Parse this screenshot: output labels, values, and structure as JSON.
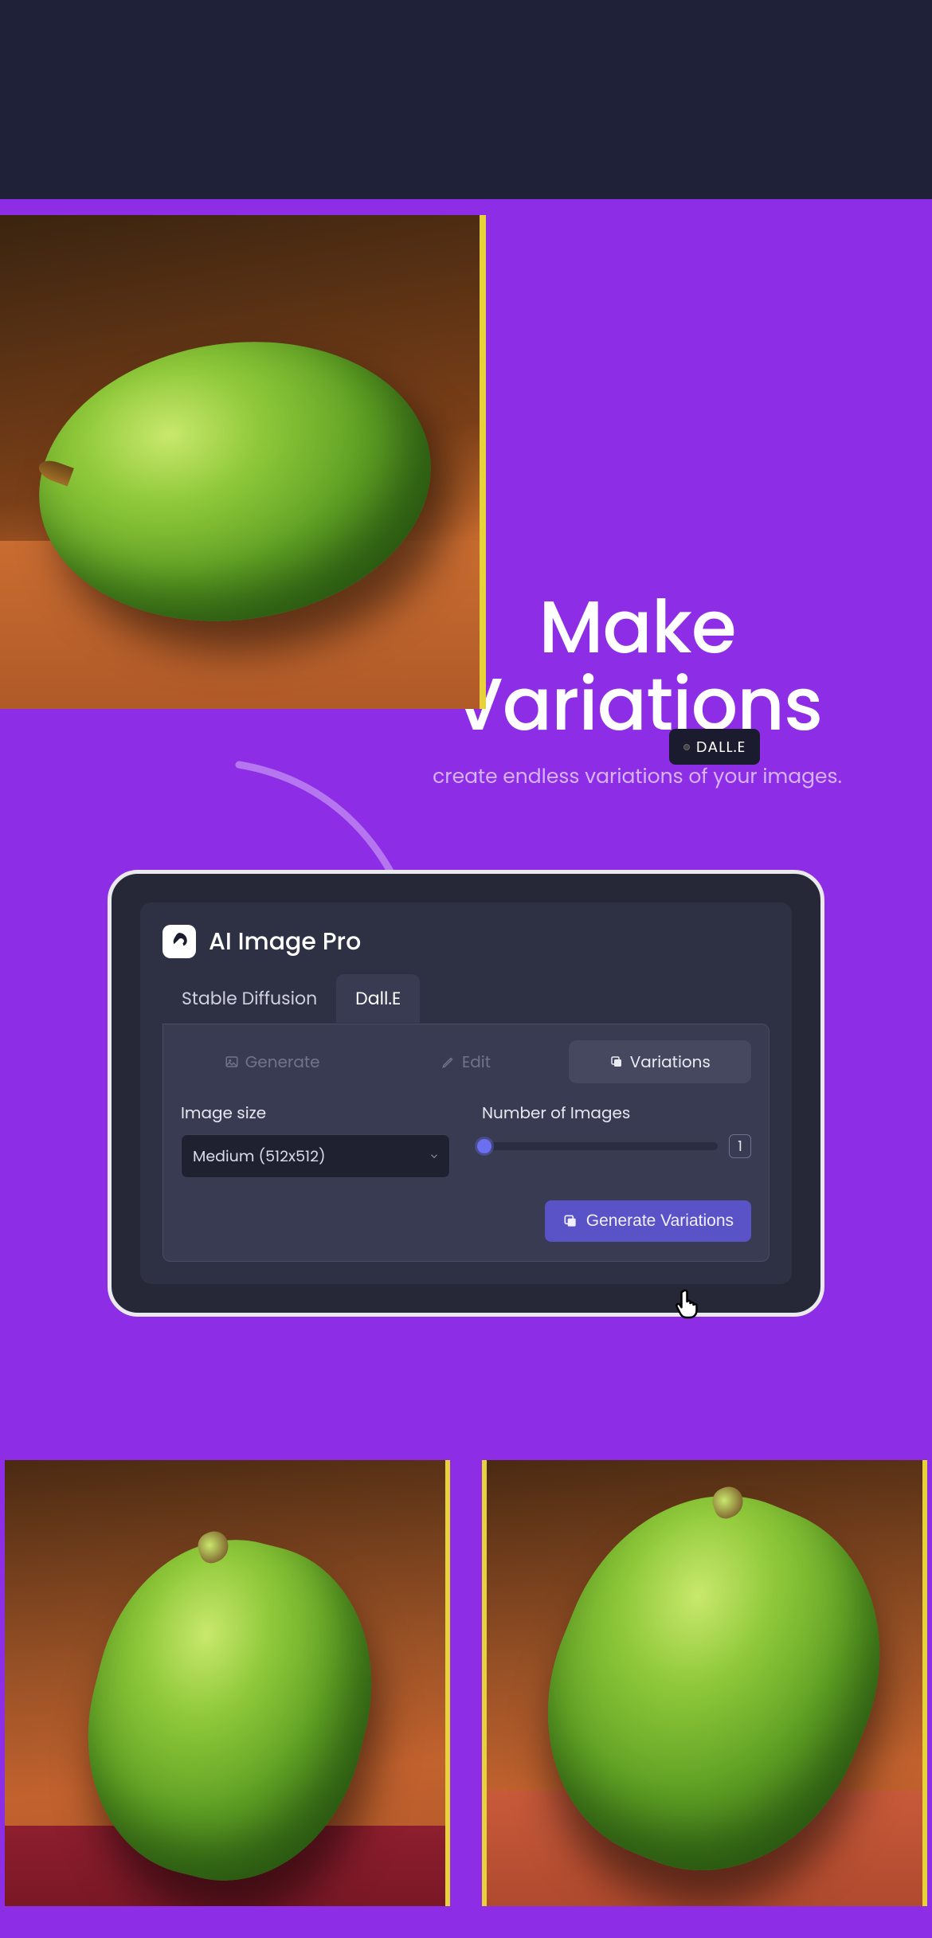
{
  "badge": {
    "label": "DALL.E"
  },
  "heading": {
    "title_line1": "Make",
    "title_line2": "Variations",
    "subtitle": "create endless variations of your images."
  },
  "app": {
    "brand": "AI Image Pro",
    "tabs": [
      {
        "label": "Stable Diffusion",
        "active": false
      },
      {
        "label": "Dall.E",
        "active": true
      }
    ],
    "subtabs": [
      {
        "label": "Generate",
        "icon": "image-icon",
        "active": false,
        "disabled": true
      },
      {
        "label": "Edit",
        "icon": "pencil-icon",
        "active": false,
        "disabled": true
      },
      {
        "label": "Variations",
        "icon": "copy-icon",
        "active": true,
        "disabled": false
      }
    ],
    "image_size": {
      "label": "Image size",
      "value": "Medium (512x512)"
    },
    "num_images": {
      "label": "Number of Images",
      "value": "1"
    },
    "cta_label": "Generate Variations"
  },
  "colors": {
    "purple_bg": "#8e2de6",
    "dark_bg": "#1f2138",
    "card_bg": "#262838",
    "panel_bg": "#2e3044",
    "accent": "#5a52c7"
  }
}
